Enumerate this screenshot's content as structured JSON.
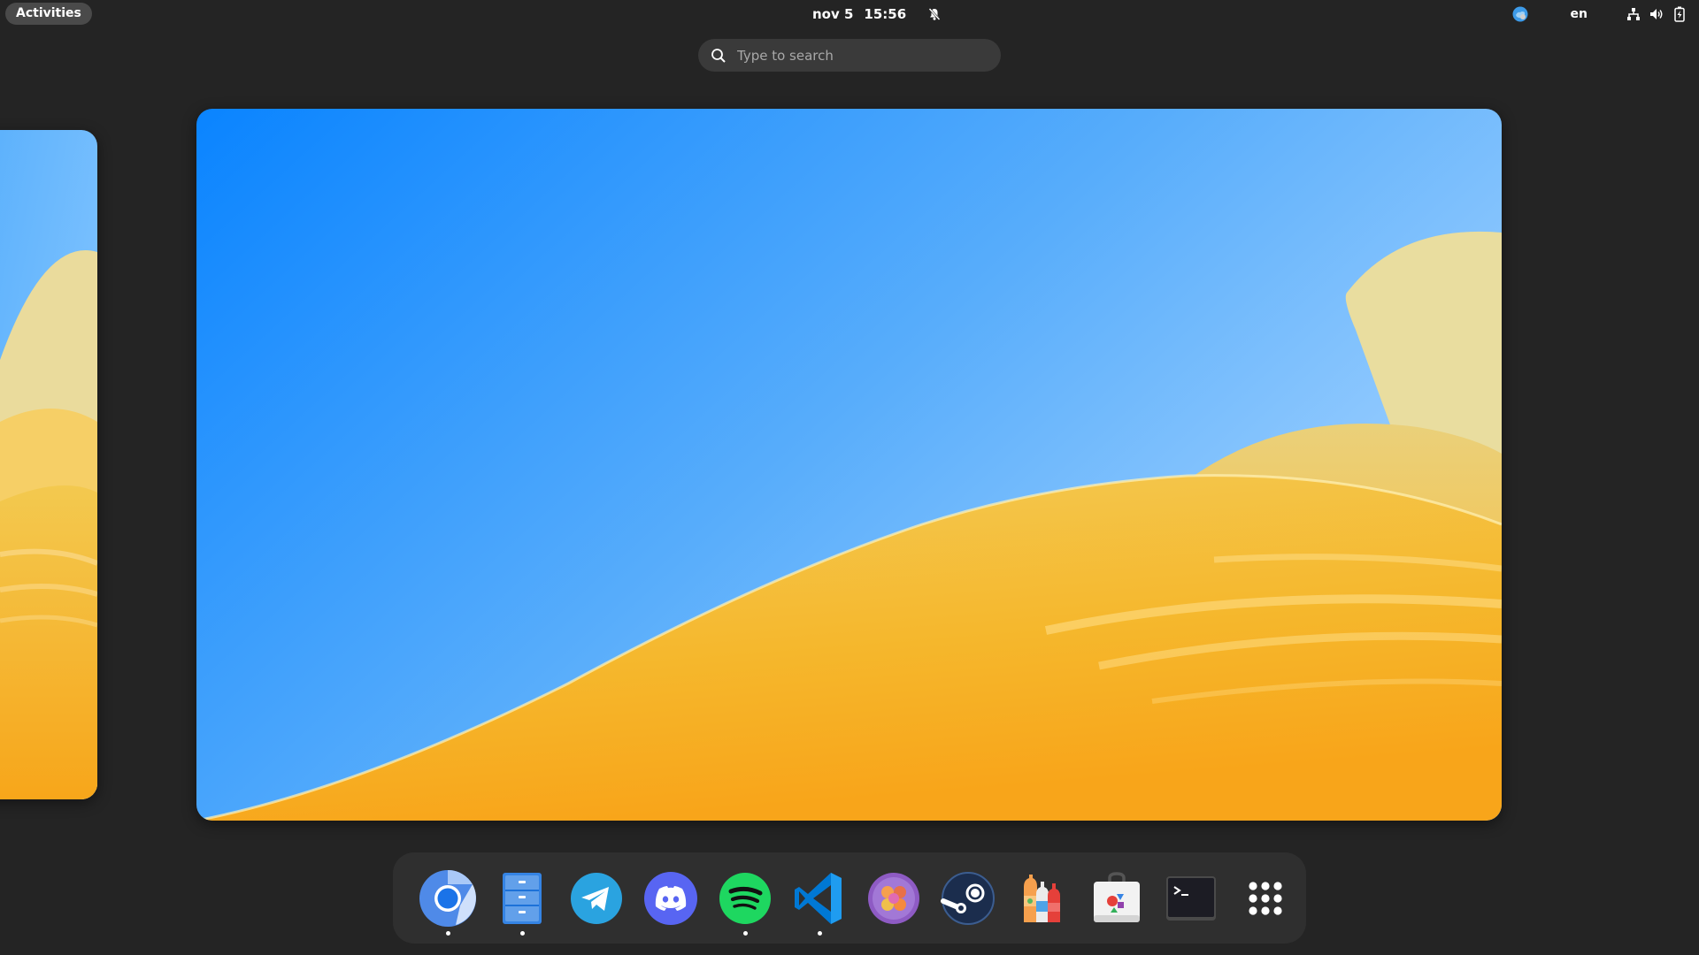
{
  "topbar": {
    "activities_label": "Activities",
    "date": "nov 5",
    "time": "15:56",
    "language": "en"
  },
  "search": {
    "placeholder": "Type to search"
  },
  "dock": {
    "apps": [
      {
        "name": "Chromium",
        "icon": "chromium-icon",
        "running": true
      },
      {
        "name": "Files",
        "icon": "files-icon",
        "running": true
      },
      {
        "name": "Telegram",
        "icon": "telegram-icon",
        "running": false
      },
      {
        "name": "Discord",
        "icon": "discord-icon",
        "running": false
      },
      {
        "name": "Spotify",
        "icon": "spotify-icon",
        "running": true
      },
      {
        "name": "Visual Studio Code",
        "icon": "vscode-icon",
        "running": true
      },
      {
        "name": "Flatseal",
        "icon": "flatseal-icon",
        "running": false
      },
      {
        "name": "Steam",
        "icon": "steam-icon",
        "running": false
      },
      {
        "name": "Bottles",
        "icon": "bottles-icon",
        "running": false
      },
      {
        "name": "Software",
        "icon": "software-store-icon",
        "running": false
      },
      {
        "name": "Terminal",
        "icon": "terminal-icon",
        "running": false
      },
      {
        "name": "Show Apps",
        "icon": "app-grid-icon",
        "running": false
      }
    ]
  },
  "colors": {
    "panel": "#242424",
    "dock": "#2f2f2f",
    "sky_top": "#0a84ff",
    "sky_light": "#8ec8ff",
    "dune": "#f5c23a",
    "dune_dark": "#f6a518"
  }
}
